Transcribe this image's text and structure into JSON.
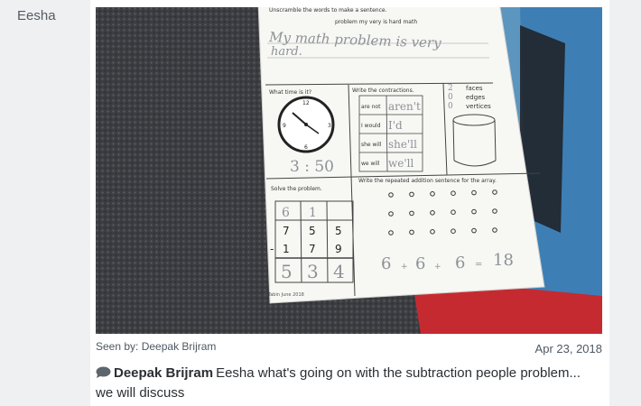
{
  "post": {
    "author": "Eesha",
    "seen_by": "Seen by: Deepak Brijram",
    "date": "Apr 23, 2018"
  },
  "comment": {
    "icon": "speech-bubble-icon",
    "commenter": "Deepak Brijram",
    "text": "Eesha what's going on with the subtraction people problem... we will discuss"
  },
  "worksheet": {
    "instruction_unscramble": "Unscramble the words to make a sentence.",
    "scrambled_words": "problem my very is hard math",
    "handwritten_sentence_line1": "My math problem is very",
    "handwritten_sentence_line2": "hard.",
    "clock_prompt": "What time is it?",
    "clock_answer": "3 : 50",
    "contractions_prompt": "Write the contractions.",
    "contraction_rows": [
      {
        "words": "are not",
        "answer": "aren't"
      },
      {
        "words": "I would",
        "answer": "I'd"
      },
      {
        "words": "she will",
        "answer": "she'll"
      },
      {
        "words": "we will",
        "answer": "we'll"
      }
    ],
    "shape_answers": [
      {
        "count": "2",
        "label": "faces"
      },
      {
        "count": "0",
        "label": "edges"
      },
      {
        "count": "0",
        "label": "vertices"
      }
    ],
    "solve_prompt": "Solve the problem.",
    "subtraction": {
      "borrow": [
        "6",
        "1",
        ""
      ],
      "top": [
        "7",
        "5",
        "5"
      ],
      "operator": "-",
      "bottom": [
        "1",
        "7",
        "9"
      ],
      "answer": [
        "5",
        "3",
        "4"
      ]
    },
    "array_prompt": "Write the repeated addition sentence for the array.",
    "array_answer": [
      "6",
      "+",
      "6",
      "+",
      "6",
      "=",
      "18"
    ],
    "footer": "©Tabin June 2018"
  },
  "colors": {
    "page_bg": "#eef0f2",
    "card_bg": "#ffffff",
    "carpet_dark": "#3a3c40",
    "carpet_blue": "#3b7fb6",
    "carpet_red": "#c9262f",
    "pencil": "#8d9296"
  }
}
